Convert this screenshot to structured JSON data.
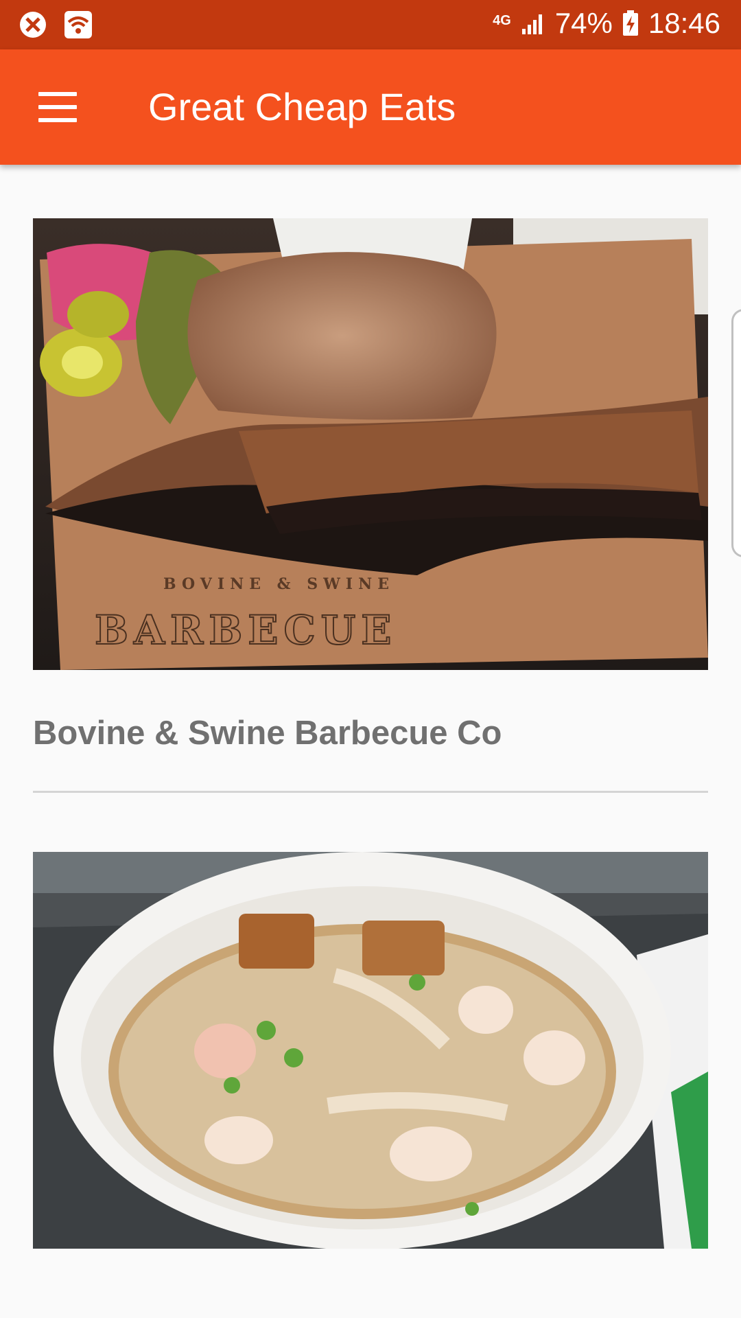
{
  "status_bar": {
    "network_type": "4G",
    "battery": "74%",
    "time": "18:46",
    "icons": [
      "no-disturb-icon",
      "wifi-hotspot-icon",
      "signal-icon",
      "battery-charging-icon"
    ]
  },
  "app_bar": {
    "title": "Great Cheap Eats",
    "menu_icon": "hamburger-menu-icon",
    "color": "#f4511e",
    "status_color": "#c2390f"
  },
  "restaurants": [
    {
      "name": "Bovine & Swine Barbecue Co",
      "image": "brisket and pulled pork on paper with pickles and jalapenos",
      "image_text": "BOVINE & SWINE BARBECUE COMPANY"
    },
    {
      "name": "",
      "image": "bowl of curry laksa soup with shrimp and tofu"
    }
  ]
}
